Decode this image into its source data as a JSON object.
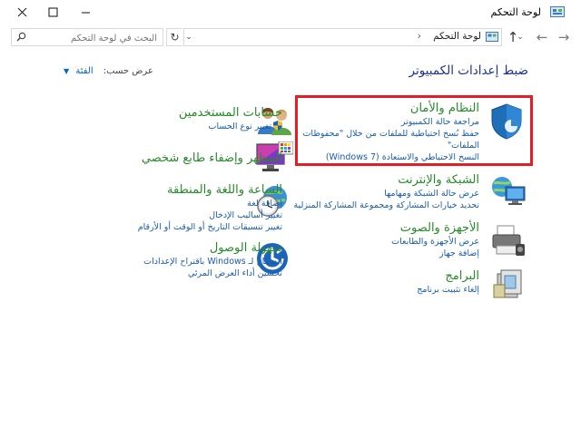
{
  "window": {
    "title": "لوحة التحكم"
  },
  "address": {
    "crumb": "لوحة التحكم",
    "separator": "›"
  },
  "search": {
    "placeholder": "البحث في لوحة التحكم"
  },
  "header": {
    "title": "ضبط إعدادات الكمبيوتر",
    "view_by_label": "عرض حسب:",
    "view_by_value": "الفئة"
  },
  "right_column": [
    {
      "title": "النظام والأمان",
      "links": [
        "مراجعة حالة الكمبيوتر",
        "حفظ نُسخ احتياطية للملفات من خلال \"محفوظات",
        "الملفات\"",
        "النسخ الاحتياطي والاستعادة (Windows 7)"
      ]
    },
    {
      "title": "الشبكة والإنترنت",
      "links": [
        "عرض حالة الشبكة ومهامها",
        "تحديد خيارات المشاركة ومجموعة المشاركة المنزلية"
      ]
    },
    {
      "title": "الأجهزة والصوت",
      "links": [
        "عرض الأجهزة والطابعات",
        "إضافة جهاز"
      ]
    },
    {
      "title": "البرامج",
      "links": [
        "إلغاء تثبيت برنامج"
      ]
    }
  ],
  "left_column": [
    {
      "title": "حسابات المستخدمين",
      "links": [
        "تغيير نوع الحساب"
      ]
    },
    {
      "title": "المظهر وإضفاء طابع شخصي",
      "links": []
    },
    {
      "title": "الساعة واللغة والمنطقة",
      "links": [
        "إضافة لغة",
        "تغيير أساليب الإدخال",
        "تغيير تنسيقات التاريخ أو الوقت أو الأرقام"
      ]
    },
    {
      "title": "سهولة الوصول",
      "links": [
        "السماح لـ Windows باقتراح الإعدادات",
        "تحسين أداء العرض المرئي"
      ]
    }
  ],
  "colors": {
    "category_title": "#268a2a",
    "link": "#1a5cb0",
    "heading": "#1e3287",
    "highlight": "#e31e24"
  }
}
